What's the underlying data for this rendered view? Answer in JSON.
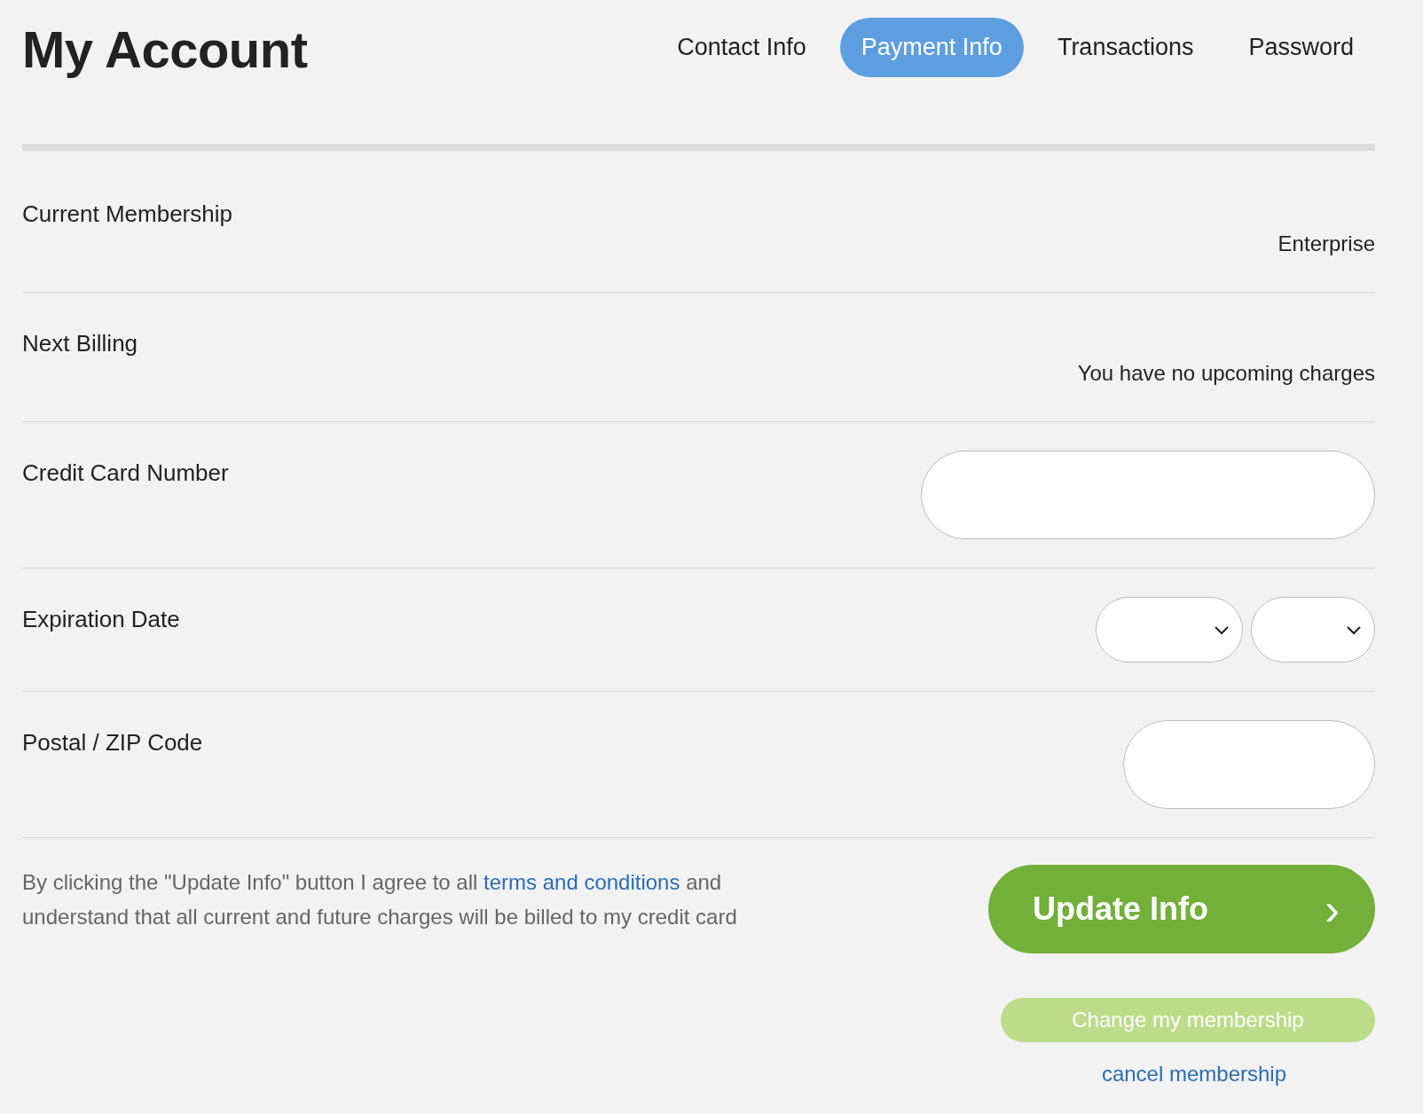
{
  "title": "My Account",
  "tabs": [
    {
      "label": "Contact Info",
      "selected": false
    },
    {
      "label": "Payment Info",
      "selected": true
    },
    {
      "label": "Transactions",
      "selected": false
    },
    {
      "label": "Password",
      "selected": false
    }
  ],
  "rows": [
    {
      "label": "Current Membership",
      "kind": "text",
      "value": "Enterprise"
    },
    {
      "label": "Next Billing",
      "kind": "text",
      "value": "You have no upcoming charges"
    },
    {
      "label": "Credit Card Number",
      "kind": "wide_input"
    },
    {
      "label": "Expiration Date",
      "kind": "date_selects"
    },
    {
      "label": "Postal / ZIP Code",
      "kind": "short_input"
    }
  ],
  "agreement": {
    "before": "By clicking the \"Update Info\" button I agree to all",
    "link": "terms and conditions",
    "after": "and understand that all current and future charges will be billed to my credit card"
  },
  "update_button": {
    "label": "Update Info",
    "chevron": "›"
  },
  "change_button": {
    "label": "Change my membership"
  },
  "cancel_link": "cancel membership"
}
